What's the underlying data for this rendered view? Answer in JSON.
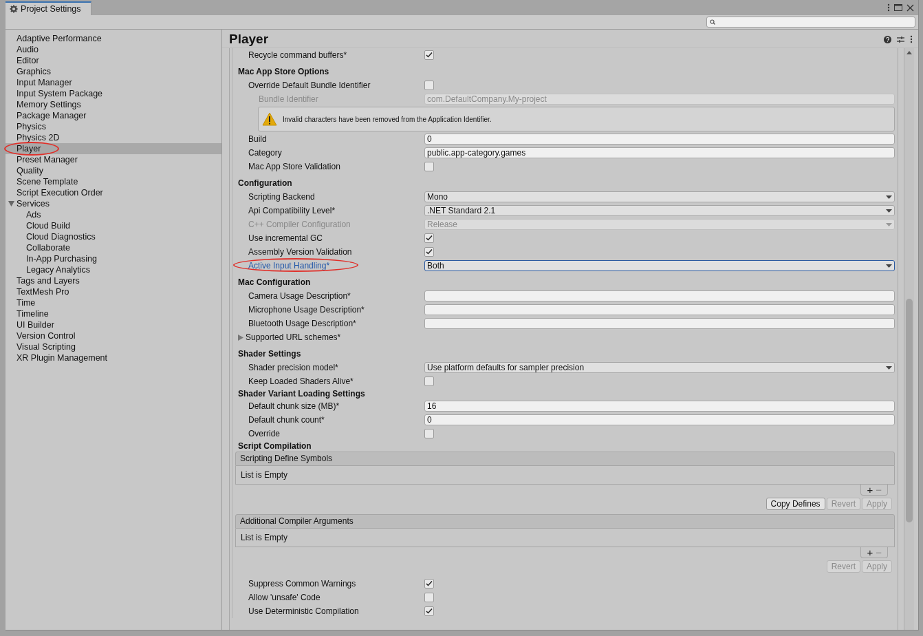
{
  "window": {
    "tab": "Project Settings"
  },
  "sidebar": {
    "items": [
      {
        "label": "Adaptive Performance",
        "selected": false,
        "circled": false
      },
      {
        "label": "Audio",
        "selected": false,
        "circled": false
      },
      {
        "label": "Editor",
        "selected": false,
        "circled": false
      },
      {
        "label": "Graphics",
        "selected": false,
        "circled": false
      },
      {
        "label": "Input Manager",
        "selected": false,
        "circled": false
      },
      {
        "label": "Input System Package",
        "selected": false,
        "circled": false
      },
      {
        "label": "Memory Settings",
        "selected": false,
        "circled": false
      },
      {
        "label": "Package Manager",
        "selected": false,
        "circled": false
      },
      {
        "label": "Physics",
        "selected": false,
        "circled": false
      },
      {
        "label": "Physics 2D",
        "selected": false,
        "circled": false
      },
      {
        "label": "Player",
        "selected": true,
        "circled": true
      },
      {
        "label": "Preset Manager",
        "selected": false,
        "circled": false
      },
      {
        "label": "Quality",
        "selected": false,
        "circled": false
      },
      {
        "label": "Scene Template",
        "selected": false,
        "circled": false
      },
      {
        "label": "Script Execution Order",
        "selected": false,
        "circled": false
      },
      {
        "label": "Services",
        "selected": false,
        "circled": false,
        "expanded": true,
        "children": [
          {
            "label": "Ads",
            "selected": false,
            "circled": false
          },
          {
            "label": "Cloud Build",
            "selected": false,
            "circled": false
          },
          {
            "label": "Cloud Diagnostics",
            "selected": false,
            "circled": false
          },
          {
            "label": "Collaborate",
            "selected": false,
            "circled": false
          },
          {
            "label": "In-App Purchasing",
            "selected": false,
            "circled": false
          },
          {
            "label": "Legacy Analytics",
            "selected": false,
            "circled": false
          }
        ]
      },
      {
        "label": "Tags and Layers",
        "selected": false,
        "circled": false
      },
      {
        "label": "TextMesh Pro",
        "selected": false,
        "circled": false
      },
      {
        "label": "Time",
        "selected": false,
        "circled": false
      },
      {
        "label": "Timeline",
        "selected": false,
        "circled": false
      },
      {
        "label": "UI Builder",
        "selected": false,
        "circled": false
      },
      {
        "label": "Version Control",
        "selected": false,
        "circled": false
      },
      {
        "label": "Visual Scripting",
        "selected": false,
        "circled": false
      },
      {
        "label": "XR Plugin Management",
        "selected": false,
        "circled": false
      }
    ]
  },
  "panel": {
    "title": "Player",
    "rows": [
      {
        "kind": "checkbox",
        "label": "Recycle command buffers*",
        "checked": true
      },
      {
        "kind": "section",
        "label": "Mac App Store Options"
      },
      {
        "kind": "checkbox",
        "label": "Override Default Bundle Identifier",
        "checked": false,
        "children": [
          {
            "kind": "text",
            "label": "Bundle Identifier",
            "value": "com.DefaultCompany.My-project",
            "disabled": true
          },
          {
            "kind": "warning",
            "text": "Invalid characters have been removed from the Application Identifier."
          }
        ]
      },
      {
        "kind": "text",
        "label": "Build",
        "value": "0",
        "disabled": false
      },
      {
        "kind": "text",
        "label": "Category",
        "value": "public.app-category.games",
        "disabled": false
      },
      {
        "kind": "checkbox",
        "label": "Mac App Store Validation",
        "checked": false
      },
      {
        "kind": "section",
        "label": "Configuration"
      },
      {
        "kind": "dropdown",
        "label": "Scripting Backend",
        "value": "Mono",
        "disabled": false,
        "focused": false,
        "circled": false
      },
      {
        "kind": "dropdown",
        "label": "Api Compatibility Level*",
        "value": ".NET Standard 2.1",
        "disabled": false,
        "focused": false,
        "circled": false
      },
      {
        "kind": "dropdown",
        "label": "C++ Compiler Configuration",
        "value": "Release",
        "disabled": true,
        "focused": false,
        "circled": false
      },
      {
        "kind": "checkbox",
        "label": "Use incremental GC",
        "checked": true
      },
      {
        "kind": "checkbox",
        "label": "Assembly Version Validation",
        "checked": true
      },
      {
        "kind": "dropdown",
        "label": "Active Input Handling*",
        "value": "Both",
        "disabled": false,
        "focused": true,
        "circled": true
      },
      {
        "kind": "section",
        "label": "Mac Configuration"
      },
      {
        "kind": "text",
        "label": "Camera Usage Description*",
        "disabled": false
      },
      {
        "kind": "text",
        "label": "Microphone Usage Description*",
        "disabled": false
      },
      {
        "kind": "text",
        "label": "Bluetooth Usage Description*",
        "disabled": false
      },
      {
        "kind": "foldout",
        "label": "Supported URL schemes*",
        "expanded": false
      },
      {
        "kind": "section",
        "label": "Shader Settings"
      },
      {
        "kind": "dropdown",
        "label": "Shader precision model*",
        "value": "Use platform defaults for sampler precision",
        "disabled": false,
        "focused": false,
        "circled": false
      },
      {
        "kind": "checkbox",
        "label": "Keep Loaded Shaders Alive*",
        "checked": false
      },
      {
        "kind": "group",
        "label": "Shader Variant Loading Settings"
      },
      {
        "kind": "text",
        "label": "Default chunk size (MB)*",
        "value": "16",
        "disabled": false
      },
      {
        "kind": "text",
        "label": "Default chunk count*",
        "value": "0",
        "disabled": false
      },
      {
        "kind": "checkbox",
        "label": "Override",
        "checked": false
      },
      {
        "kind": "group",
        "label": "Script Compilation"
      },
      {
        "kind": "list",
        "title": "Scripting Define Symbols",
        "empty_text": "List is Empty",
        "add": {
          "label": "+",
          "disabled": false
        },
        "remove": {
          "label": "−",
          "disabled": true
        },
        "buttons": [
          {
            "label": "Copy Defines",
            "disabled": false
          },
          {
            "label": "Revert",
            "disabled": true
          },
          {
            "label": "Apply",
            "disabled": true
          }
        ]
      },
      {
        "kind": "list",
        "title": "Additional Compiler Arguments",
        "empty_text": "List is Empty",
        "add": {
          "label": "+",
          "disabled": false
        },
        "remove": {
          "label": "−",
          "disabled": true
        },
        "buttons": [
          {
            "label": "Revert",
            "disabled": true
          },
          {
            "label": "Apply",
            "disabled": true
          }
        ]
      },
      {
        "kind": "checkbox",
        "label": "Suppress Common Warnings",
        "checked": true
      },
      {
        "kind": "checkbox",
        "label": "Allow 'unsafe' Code",
        "checked": false
      },
      {
        "kind": "checkbox",
        "label": "Use Deterministic Compilation",
        "checked": true
      }
    ]
  }
}
